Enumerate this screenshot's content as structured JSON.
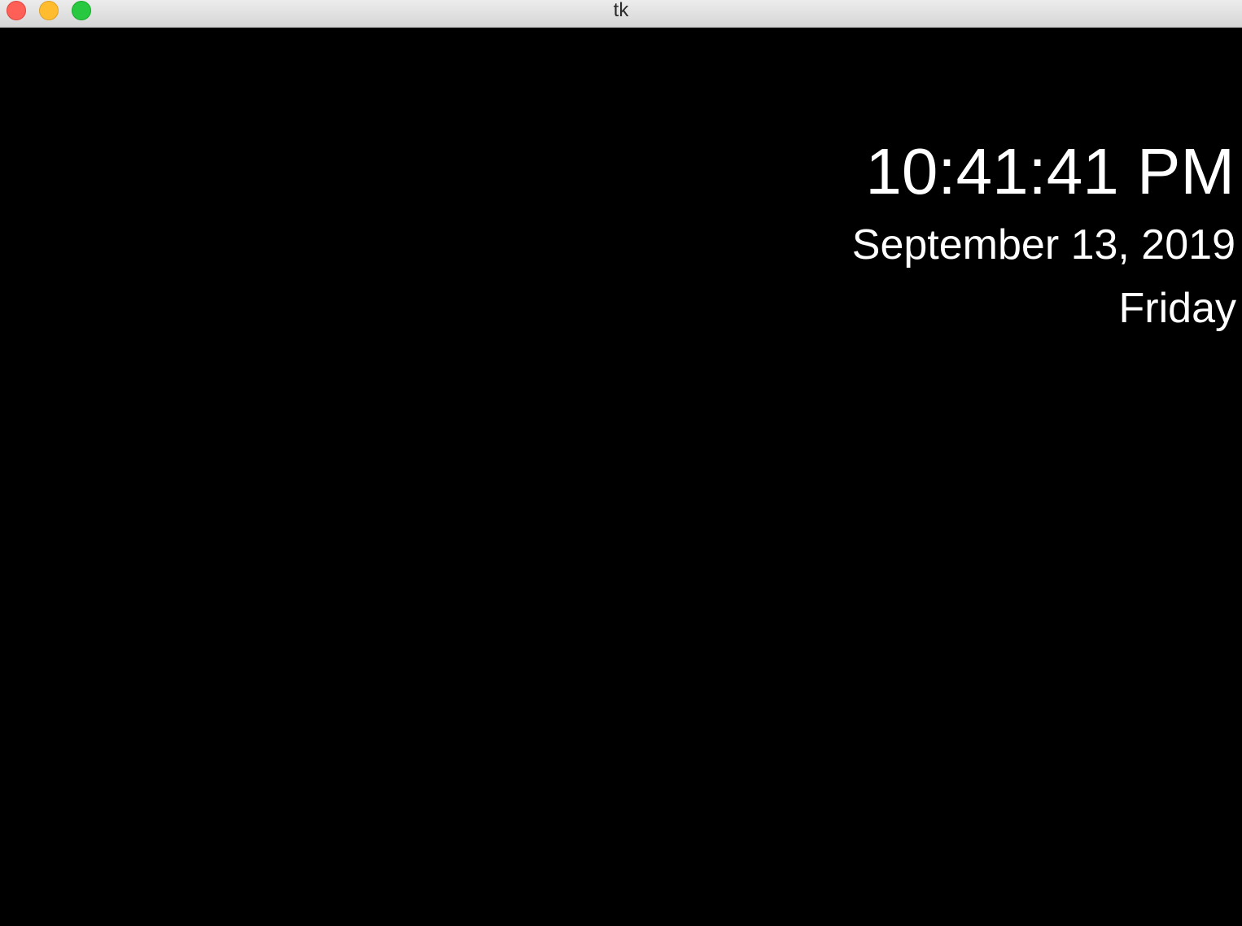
{
  "window": {
    "title": "tk"
  },
  "clock": {
    "time": "10:41:41 PM",
    "date": "September 13, 2019",
    "day": "Friday"
  },
  "colors": {
    "background": "#000000",
    "text": "#ffffff",
    "close": "#fe5f57",
    "minimize": "#febc2e",
    "zoom": "#28c840"
  }
}
